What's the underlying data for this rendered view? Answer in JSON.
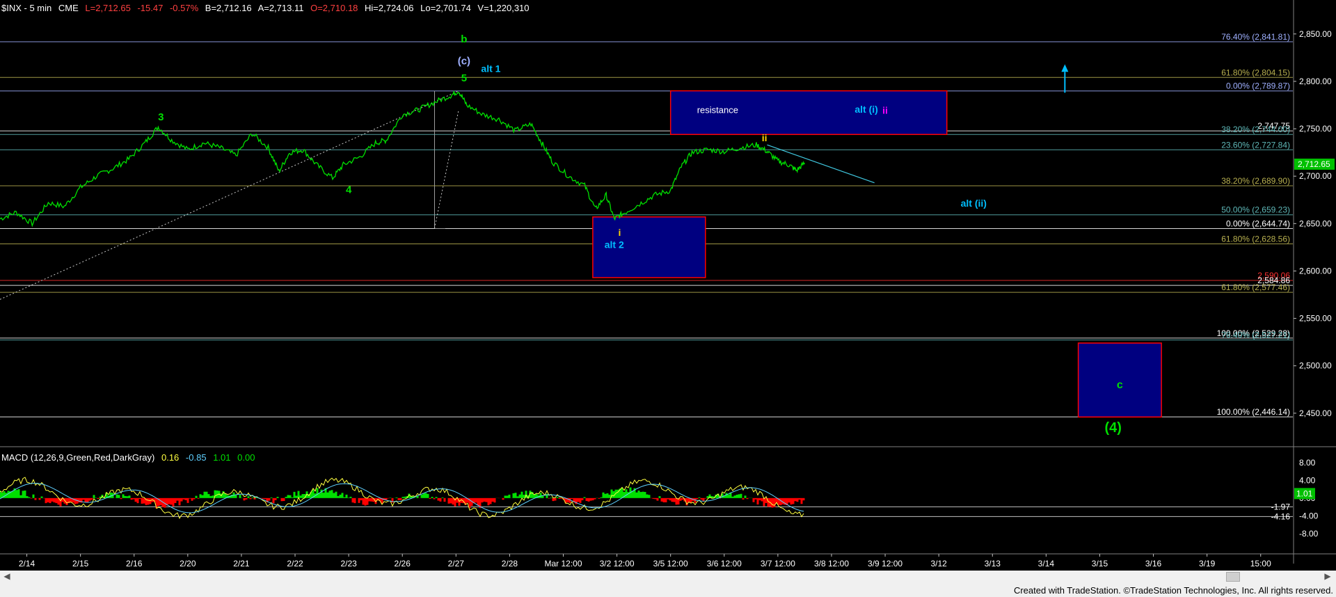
{
  "header": {
    "symbol": "$INX - 5 min",
    "exchange": "CME",
    "last": "L=2,712.65",
    "change": "-15.47",
    "pct": "-0.57%",
    "bid": "B=2,712.16",
    "ask": "A=2,713.11",
    "open": "O=2,710.18",
    "high": "Hi=2,724.06",
    "low": "Lo=2,701.74",
    "volume": "V=1,220,310"
  },
  "macd_header": {
    "label": "MACD (12,26,9,Green,Red,DarkGray)",
    "v1": "0.16",
    "v2": "-0.85",
    "v3": "1.01",
    "v4": "0.00"
  },
  "footer": "Created with TradeStation. ©TradeStation Technologies, Inc. All rights reserved.",
  "colors": {
    "price": "#00e000",
    "macd_up": "#00e000",
    "macd_down": "#ff0000",
    "yellow": "#ffd700",
    "cyan": "#00bfff",
    "magenta": "#ff00ff",
    "box_fill": "#000080",
    "box_border": "#ff0000",
    "fib_olive": "#b8b050",
    "fib_teal": "#5fb8b8",
    "fib_blue": "#9fb0ff"
  },
  "chart_data": {
    "type": "line",
    "symbol": "$INX",
    "interval": "5 min",
    "price_axis": {
      "ticks": [
        2850,
        2800,
        2750,
        2700,
        2650,
        2600,
        2550,
        2500,
        2450
      ],
      "tick_labels": [
        "2,850.00",
        "2,800.00",
        "2,750.00",
        "2,700.00",
        "2,650.00",
        "2,600.00",
        "2,550.00",
        "2,500.00",
        "2,450.00"
      ],
      "ylim": [
        2422,
        2877
      ],
      "last_price_label": "2,712.65"
    },
    "x_axis": {
      "labels": [
        "2/14",
        "2/15",
        "2/16",
        "2/20",
        "2/21",
        "2/22",
        "2/23",
        "2/26",
        "2/27",
        "2/28",
        "Mar 12:00",
        "3/2 12:00",
        "3/5 12:00",
        "3/6 12:00",
        "3/7 12:00",
        "3/8 12:00",
        "3/9 12:00",
        "3/12",
        "3/13",
        "3/14",
        "3/15",
        "3/16",
        "3/19",
        "15:00"
      ],
      "positions": [
        0.5,
        1.5,
        2.5,
        3.5,
        4.5,
        5.5,
        6.5,
        7.5,
        8.5,
        9.5,
        10.5,
        11.5,
        12.5,
        13.5,
        14.5,
        15.5,
        16.5,
        17.5,
        18.5,
        19.5,
        20.5,
        21.5,
        22.5,
        23.5
      ],
      "xlim": [
        0,
        24.1
      ]
    },
    "price_path": [
      [
        0.0,
        2655
      ],
      [
        0.3,
        2662
      ],
      [
        0.6,
        2650
      ],
      [
        0.9,
        2672
      ],
      [
        1.2,
        2668
      ],
      [
        1.5,
        2688
      ],
      [
        1.8,
        2700
      ],
      [
        2.1,
        2708
      ],
      [
        2.4,
        2718
      ],
      [
        2.7,
        2735
      ],
      [
        2.95,
        2752
      ],
      [
        3.2,
        2738
      ],
      [
        3.5,
        2728
      ],
      [
        3.8,
        2735
      ],
      [
        4.1,
        2730
      ],
      [
        4.4,
        2722
      ],
      [
        4.7,
        2745
      ],
      [
        5.0,
        2730
      ],
      [
        5.2,
        2705
      ],
      [
        5.4,
        2725
      ],
      [
        5.65,
        2728
      ],
      [
        5.9,
        2712
      ],
      [
        6.2,
        2698
      ],
      [
        6.4,
        2712
      ],
      [
        6.7,
        2720
      ],
      [
        7.0,
        2735
      ],
      [
        7.2,
        2738
      ],
      [
        7.5,
        2765
      ],
      [
        7.8,
        2770
      ],
      [
        8.1,
        2778
      ],
      [
        8.4,
        2785
      ],
      [
        8.55,
        2790
      ],
      [
        8.7,
        2775
      ],
      [
        9.0,
        2765
      ],
      [
        9.3,
        2760
      ],
      [
        9.6,
        2748
      ],
      [
        9.9,
        2755
      ],
      [
        10.1,
        2735
      ],
      [
        10.3,
        2715
      ],
      [
        10.6,
        2700
      ],
      [
        10.9,
        2690
      ],
      [
        11.1,
        2665
      ],
      [
        11.3,
        2680
      ],
      [
        11.45,
        2655
      ],
      [
        11.6,
        2660
      ],
      [
        11.9,
        2670
      ],
      [
        12.2,
        2680
      ],
      [
        12.5,
        2685
      ],
      [
        12.7,
        2710
      ],
      [
        12.9,
        2725
      ],
      [
        13.2,
        2728
      ],
      [
        13.5,
        2726
      ],
      [
        13.8,
        2730
      ],
      [
        14.1,
        2733
      ],
      [
        14.3,
        2726
      ],
      [
        14.5,
        2716
      ],
      [
        14.7,
        2712
      ],
      [
        14.85,
        2706
      ],
      [
        15.0,
        2714
      ]
    ],
    "fib_levels": [
      {
        "value": 2841.81,
        "label": "76.40% (2,841.81)",
        "color": "#9fb0ff"
      },
      {
        "value": 2804.15,
        "label": "61.80% (2,804.15)",
        "color": "#b8b050"
      },
      {
        "value": 2789.87,
        "label": "0.00% (2,789.87)",
        "color": "#9fb0ff"
      },
      {
        "value": 2747.75,
        "label": "2,747.75",
        "color": "#ffffff"
      },
      {
        "value": 2744.0,
        "label": "38.20% (2,744.00)",
        "color": "#5fb8b8"
      },
      {
        "value": 2727.84,
        "label": "23.60% (2,727.84)",
        "color": "#5fb8b8"
      },
      {
        "value": 2689.9,
        "label": "38.20% (2,689.90)",
        "color": "#b8b050"
      },
      {
        "value": 2659.23,
        "label": "50.00% (2,659.23)",
        "color": "#5fb8b8"
      },
      {
        "value": 2644.74,
        "label": "0.00% (2,644.74)",
        "color": "#ffffff"
      },
      {
        "value": 2628.56,
        "label": "61.80% (2,628.56)",
        "color": "#b8b050"
      },
      {
        "value": 2590.06,
        "label": "2,590.06",
        "color": "#ff3030"
      },
      {
        "value": 2584.86,
        "label": "2,584.86",
        "color": "#ffffff"
      },
      {
        "value": 2577.46,
        "label": "61.80% (2,577.46)",
        "color": "#b8b050"
      },
      {
        "value": 2529.28,
        "label": "100.00% (2,529.28)",
        "color": "#ffffff"
      },
      {
        "value": 2527.21,
        "label": "76.40% (2,527.21)",
        "color": "#5fb8b8"
      },
      {
        "value": 2446.14,
        "label": "100.00% (2,446.14)",
        "color": "#ffffff"
      }
    ],
    "zones": [
      {
        "name": "resistance",
        "x0": 12.5,
        "x1": 17.65,
        "y0": 2744,
        "y1": 2790,
        "label": "resistance"
      },
      {
        "name": "support",
        "x0": 11.05,
        "x1": 13.15,
        "y0": 2593,
        "y1": 2657,
        "label": ""
      },
      {
        "name": "target-c",
        "x0": 20.1,
        "x1": 21.65,
        "y0": 2446,
        "y1": 2524,
        "label": "c"
      }
    ],
    "annotations": [
      {
        "text": "3",
        "x": 3.0,
        "y": 2759,
        "color": "#00e000"
      },
      {
        "text": "4",
        "x": 6.5,
        "y": 2682,
        "color": "#00e000"
      },
      {
        "text": "5",
        "x": 8.65,
        "y": 2800,
        "color": "#00e000"
      },
      {
        "text": "(c)",
        "x": 8.65,
        "y": 2818,
        "color": "#9fb0ff"
      },
      {
        "text": "b",
        "x": 8.65,
        "y": 2841,
        "color": "#00e000"
      },
      {
        "text": "alt 1",
        "x": 9.15,
        "y": 2810,
        "color": "#00bfff"
      },
      {
        "text": "i",
        "x": 11.55,
        "y": 2637,
        "color": "#ffd700"
      },
      {
        "text": "alt 2",
        "x": 11.45,
        "y": 2624,
        "color": "#00bfff"
      },
      {
        "text": "ii",
        "x": 14.25,
        "y": 2737,
        "color": "#ffd700"
      },
      {
        "text": "alt (i)",
        "x": 16.15,
        "y": 2767,
        "color": "#00bfff"
      },
      {
        "text": "ii",
        "x": 16.5,
        "y": 2766,
        "color": "#ff00ff"
      },
      {
        "text": "alt (ii)",
        "x": 18.15,
        "y": 2668,
        "color": "#00bfff"
      },
      {
        "text": "(4)",
        "x": 20.75,
        "y": 2430,
        "color": "#00e000"
      }
    ],
    "macd": {
      "axis_ticks": [
        8,
        4,
        0,
        -4,
        -8
      ],
      "axis_labels": [
        "8.00",
        "4.00",
        "0.00",
        "-4.00",
        "-8.00"
      ],
      "ylim": [
        -11,
        10
      ],
      "current_value": "1.01",
      "ref_levels": [
        {
          "value": -1.97,
          "label": "-1.97"
        },
        {
          "value": -4.16,
          "label": "-4.16"
        }
      ]
    }
  }
}
